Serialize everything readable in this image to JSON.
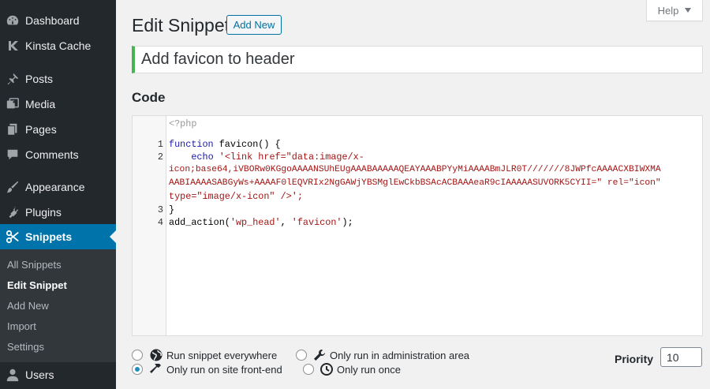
{
  "sidebar": {
    "items": [
      {
        "label": "Dashboard",
        "icon": "dashboard-icon"
      },
      {
        "label": "Kinsta Cache",
        "icon": "kinsta-icon"
      },
      {
        "label": "Posts",
        "icon": "pushpin-icon"
      },
      {
        "label": "Media",
        "icon": "media-icon"
      },
      {
        "label": "Pages",
        "icon": "pages-icon"
      },
      {
        "label": "Comments",
        "icon": "comments-icon"
      },
      {
        "label": "Appearance",
        "icon": "paintbrush-icon"
      },
      {
        "label": "Plugins",
        "icon": "plugins-icon"
      },
      {
        "label": "Snippets",
        "icon": "scissors-icon"
      },
      {
        "label": "Users",
        "icon": "users-icon"
      }
    ],
    "submenu": [
      "All Snippets",
      "Edit Snippet",
      "Add New",
      "Import",
      "Settings"
    ],
    "active_color": "#0073aa"
  },
  "header": {
    "help_label": "Help",
    "title": "Edit Snippet",
    "add_new_label": "Add New"
  },
  "snippet": {
    "title_value": "Add favicon to header",
    "code_heading": "Code",
    "php_tag": "<?php",
    "line_numbers": [
      "1",
      "2",
      "3",
      "4"
    ],
    "code": {
      "l1_kw": "function",
      "l1_rest": " favicon() {",
      "l2_indent": "    ",
      "l2_kw": "echo",
      "l2_str": " '<link href=\"data:image/x-",
      "l2b": "icon;base64,iVBORw0KGgoAAAANSUhEUgAAABAAAAAQEAYAAABPYyMiAAAABmJLR0T///////8JWPfcAAAACXBIWXMA",
      "l2c": "AABIAAAASABGyWs+AAAAF0lEQVRIx2NgGAWjYBSMglEwCkbBSAcACBAAAeaR9cIAAAAASUVORK5CYII=\" rel=\"icon\"",
      "l2d": "type=\"image/x-icon\" />';",
      "l3": "}",
      "l4_a": "add_action(",
      "l4_s1": "'wp_head'",
      "l4_b": ", ",
      "l4_s2": "'favicon'",
      "l4_c": ");"
    }
  },
  "options": {
    "run_everywhere": "Run snippet everywhere",
    "admin_only": "Only run in administration area",
    "front_end": "Only run on site front-end",
    "run_once": "Only run once",
    "selected": "front_end"
  },
  "priority": {
    "label": "Priority",
    "value": "10"
  }
}
